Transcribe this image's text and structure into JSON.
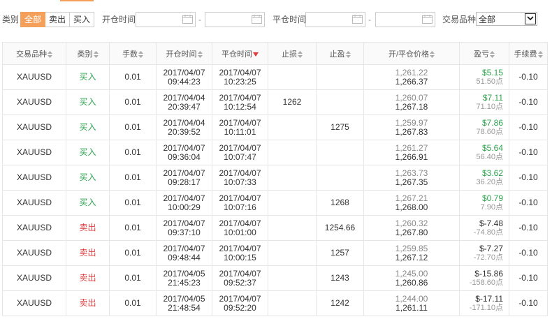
{
  "filter": {
    "category_label": "类别",
    "segments": [
      {
        "label": "全部",
        "active": true
      },
      {
        "label": "卖出",
        "active": false
      },
      {
        "label": "买入",
        "active": false
      }
    ],
    "open_time_label": "开仓时间",
    "close_time_label": "平仓时间",
    "dash": "-",
    "product_label": "交易品种",
    "product_value": "全部"
  },
  "table": {
    "headers": [
      "交易品种",
      "类别",
      "手数",
      "开仓时间",
      "平仓时间",
      "止损",
      "止盈",
      "开/平仓价格",
      "盈亏",
      "手续费"
    ],
    "rows": [
      {
        "symbol": "XAUUSD",
        "type": "买入",
        "side": "buy",
        "lots": "0.01",
        "open_date": "2017/04/07",
        "open_time": "09:44:23",
        "close_date": "2017/04/07",
        "close_time": "10:23:25",
        "sl": "",
        "tp": "",
        "open_price": "1,261.22",
        "close_price": "1,266.37",
        "pl": "$5.15",
        "pts": "51.50点",
        "fee": "-0.10"
      },
      {
        "symbol": "XAUUSD",
        "type": "买入",
        "side": "buy",
        "lots": "0.01",
        "open_date": "2017/04/04",
        "open_time": "20:39:47",
        "close_date": "2017/04/07",
        "close_time": "10:12:54",
        "sl": "1262",
        "tp": "",
        "open_price": "1,260.07",
        "close_price": "1,267.18",
        "pl": "$7.11",
        "pts": "71.10点",
        "fee": "-0.10"
      },
      {
        "symbol": "XAUUSD",
        "type": "买入",
        "side": "buy",
        "lots": "0.01",
        "open_date": "2017/04/04",
        "open_time": "20:39:52",
        "close_date": "2017/04/07",
        "close_time": "10:11:01",
        "sl": "",
        "tp": "1275",
        "open_price": "1,259.97",
        "close_price": "1,267.83",
        "pl": "$7.86",
        "pts": "78.60点",
        "fee": "-0.10"
      },
      {
        "symbol": "XAUUSD",
        "type": "买入",
        "side": "buy",
        "lots": "0.01",
        "open_date": "2017/04/07",
        "open_time": "09:36:04",
        "close_date": "2017/04/07",
        "close_time": "10:07:47",
        "sl": "",
        "tp": "",
        "open_price": "1,261.27",
        "close_price": "1,266.91",
        "pl": "$5.64",
        "pts": "56.40点",
        "fee": "-0.10"
      },
      {
        "symbol": "XAUUSD",
        "type": "买入",
        "side": "buy",
        "lots": "0.01",
        "open_date": "2017/04/07",
        "open_time": "09:28:17",
        "close_date": "2017/04/07",
        "close_time": "10:07:33",
        "sl": "",
        "tp": "",
        "open_price": "1,263.73",
        "close_price": "1,267.35",
        "pl": "$3.62",
        "pts": "36.20点",
        "fee": "-0.10"
      },
      {
        "symbol": "XAUUSD",
        "type": "买入",
        "side": "buy",
        "lots": "0.01",
        "open_date": "2017/04/07",
        "open_time": "10:00:29",
        "close_date": "2017/04/07",
        "close_time": "10:07:16",
        "sl": "",
        "tp": "1268",
        "open_price": "1,267.21",
        "close_price": "1,268.00",
        "pl": "$0.79",
        "pts": "7.90点",
        "fee": "-0.10"
      },
      {
        "symbol": "XAUUSD",
        "type": "卖出",
        "side": "sell",
        "lots": "0.01",
        "open_date": "2017/04/07",
        "open_time": "09:37:10",
        "close_date": "2017/04/07",
        "close_time": "10:01:00",
        "sl": "",
        "tp": "1254.66",
        "open_price": "1,260.32",
        "close_price": "1,267.80",
        "pl": "$-7.48",
        "pts": "-74.80点",
        "fee": "-0.10"
      },
      {
        "symbol": "XAUUSD",
        "type": "卖出",
        "side": "sell",
        "lots": "0.01",
        "open_date": "2017/04/07",
        "open_time": "09:48:44",
        "close_date": "2017/04/07",
        "close_time": "10:00:15",
        "sl": "",
        "tp": "1257",
        "open_price": "1,259.85",
        "close_price": "1,267.12",
        "pl": "$-7.27",
        "pts": "-72.70点",
        "fee": "-0.10"
      },
      {
        "symbol": "XAUUSD",
        "type": "卖出",
        "side": "sell",
        "lots": "0.01",
        "open_date": "2017/04/05",
        "open_time": "21:45:23",
        "close_date": "2017/04/07",
        "close_time": "09:52:37",
        "sl": "",
        "tp": "1243",
        "open_price": "1,245.00",
        "close_price": "1,260.86",
        "pl": "$-15.86",
        "pts": "-158.60点",
        "fee": "-0.10"
      },
      {
        "symbol": "XAUUSD",
        "type": "卖出",
        "side": "sell",
        "lots": "0.01",
        "open_date": "2017/04/05",
        "open_time": "21:48:54",
        "close_date": "2017/04/07",
        "close_time": "09:52:20",
        "sl": "",
        "tp": "1242",
        "open_price": "1,244.00",
        "close_price": "1,261.11",
        "pl": "$-17.11",
        "pts": "-171.10点",
        "fee": "-0.10"
      }
    ]
  },
  "colors": {
    "accent": "#f5a05a",
    "buy": "#2da44e",
    "sell": "#e03a3a"
  }
}
